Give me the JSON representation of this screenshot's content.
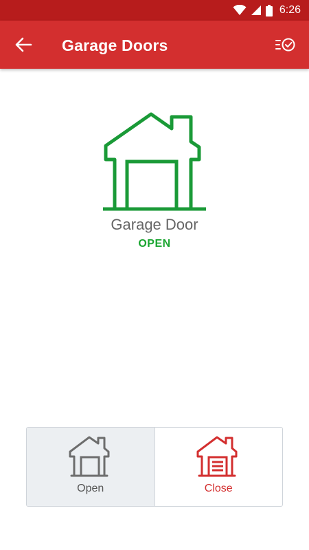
{
  "status_bar": {
    "time": "6:26",
    "icons": [
      "wifi-icon",
      "signal-icon",
      "battery-icon"
    ]
  },
  "app_bar": {
    "title": "Garage Doors",
    "back_icon": "arrow-back-icon",
    "action_icon": "history-check-icon"
  },
  "device": {
    "name": "Garage Door",
    "status": "OPEN",
    "status_color": "#1aa530",
    "icon": "garage-house-icon"
  },
  "controls": {
    "open": {
      "label": "Open",
      "icon": "garage-open-icon",
      "selected": true
    },
    "close": {
      "label": "Close",
      "icon": "garage-closed-icon",
      "color": "#d32f2f"
    }
  },
  "colors": {
    "app_bar": "#d32f2f",
    "status_bar": "#b71c1c",
    "open_state": "#1aa530"
  }
}
